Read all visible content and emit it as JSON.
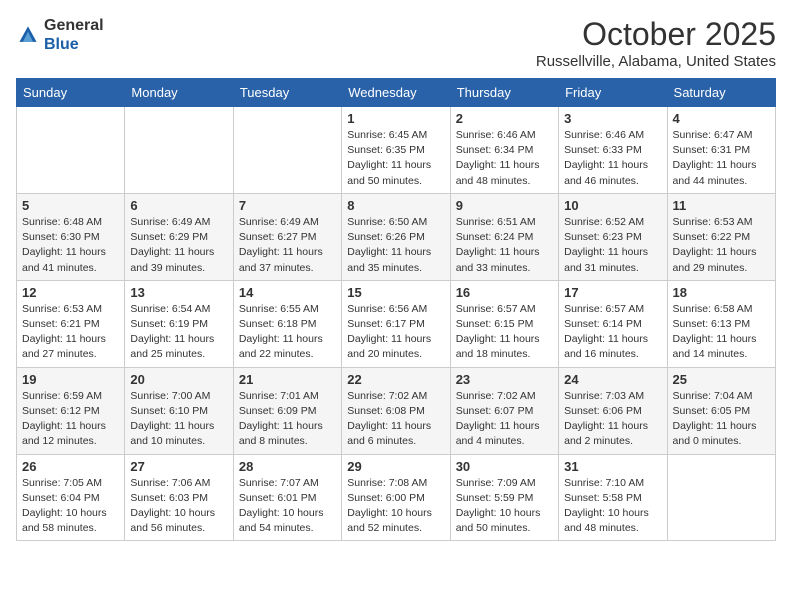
{
  "header": {
    "logo_line1": "General",
    "logo_line2": "Blue",
    "title": "October 2025",
    "subtitle": "Russellville, Alabama, United States"
  },
  "weekdays": [
    "Sunday",
    "Monday",
    "Tuesday",
    "Wednesday",
    "Thursday",
    "Friday",
    "Saturday"
  ],
  "weeks": [
    [
      {
        "day": "",
        "sunrise": "",
        "sunset": "",
        "daylight": ""
      },
      {
        "day": "",
        "sunrise": "",
        "sunset": "",
        "daylight": ""
      },
      {
        "day": "",
        "sunrise": "",
        "sunset": "",
        "daylight": ""
      },
      {
        "day": "1",
        "sunrise": "Sunrise: 6:45 AM",
        "sunset": "Sunset: 6:35 PM",
        "daylight": "Daylight: 11 hours and 50 minutes."
      },
      {
        "day": "2",
        "sunrise": "Sunrise: 6:46 AM",
        "sunset": "Sunset: 6:34 PM",
        "daylight": "Daylight: 11 hours and 48 minutes."
      },
      {
        "day": "3",
        "sunrise": "Sunrise: 6:46 AM",
        "sunset": "Sunset: 6:33 PM",
        "daylight": "Daylight: 11 hours and 46 minutes."
      },
      {
        "day": "4",
        "sunrise": "Sunrise: 6:47 AM",
        "sunset": "Sunset: 6:31 PM",
        "daylight": "Daylight: 11 hours and 44 minutes."
      }
    ],
    [
      {
        "day": "5",
        "sunrise": "Sunrise: 6:48 AM",
        "sunset": "Sunset: 6:30 PM",
        "daylight": "Daylight: 11 hours and 41 minutes."
      },
      {
        "day": "6",
        "sunrise": "Sunrise: 6:49 AM",
        "sunset": "Sunset: 6:29 PM",
        "daylight": "Daylight: 11 hours and 39 minutes."
      },
      {
        "day": "7",
        "sunrise": "Sunrise: 6:49 AM",
        "sunset": "Sunset: 6:27 PM",
        "daylight": "Daylight: 11 hours and 37 minutes."
      },
      {
        "day": "8",
        "sunrise": "Sunrise: 6:50 AM",
        "sunset": "Sunset: 6:26 PM",
        "daylight": "Daylight: 11 hours and 35 minutes."
      },
      {
        "day": "9",
        "sunrise": "Sunrise: 6:51 AM",
        "sunset": "Sunset: 6:24 PM",
        "daylight": "Daylight: 11 hours and 33 minutes."
      },
      {
        "day": "10",
        "sunrise": "Sunrise: 6:52 AM",
        "sunset": "Sunset: 6:23 PM",
        "daylight": "Daylight: 11 hours and 31 minutes."
      },
      {
        "day": "11",
        "sunrise": "Sunrise: 6:53 AM",
        "sunset": "Sunset: 6:22 PM",
        "daylight": "Daylight: 11 hours and 29 minutes."
      }
    ],
    [
      {
        "day": "12",
        "sunrise": "Sunrise: 6:53 AM",
        "sunset": "Sunset: 6:21 PM",
        "daylight": "Daylight: 11 hours and 27 minutes."
      },
      {
        "day": "13",
        "sunrise": "Sunrise: 6:54 AM",
        "sunset": "Sunset: 6:19 PM",
        "daylight": "Daylight: 11 hours and 25 minutes."
      },
      {
        "day": "14",
        "sunrise": "Sunrise: 6:55 AM",
        "sunset": "Sunset: 6:18 PM",
        "daylight": "Daylight: 11 hours and 22 minutes."
      },
      {
        "day": "15",
        "sunrise": "Sunrise: 6:56 AM",
        "sunset": "Sunset: 6:17 PM",
        "daylight": "Daylight: 11 hours and 20 minutes."
      },
      {
        "day": "16",
        "sunrise": "Sunrise: 6:57 AM",
        "sunset": "Sunset: 6:15 PM",
        "daylight": "Daylight: 11 hours and 18 minutes."
      },
      {
        "day": "17",
        "sunrise": "Sunrise: 6:57 AM",
        "sunset": "Sunset: 6:14 PM",
        "daylight": "Daylight: 11 hours and 16 minutes."
      },
      {
        "day": "18",
        "sunrise": "Sunrise: 6:58 AM",
        "sunset": "Sunset: 6:13 PM",
        "daylight": "Daylight: 11 hours and 14 minutes."
      }
    ],
    [
      {
        "day": "19",
        "sunrise": "Sunrise: 6:59 AM",
        "sunset": "Sunset: 6:12 PM",
        "daylight": "Daylight: 11 hours and 12 minutes."
      },
      {
        "day": "20",
        "sunrise": "Sunrise: 7:00 AM",
        "sunset": "Sunset: 6:10 PM",
        "daylight": "Daylight: 11 hours and 10 minutes."
      },
      {
        "day": "21",
        "sunrise": "Sunrise: 7:01 AM",
        "sunset": "Sunset: 6:09 PM",
        "daylight": "Daylight: 11 hours and 8 minutes."
      },
      {
        "day": "22",
        "sunrise": "Sunrise: 7:02 AM",
        "sunset": "Sunset: 6:08 PM",
        "daylight": "Daylight: 11 hours and 6 minutes."
      },
      {
        "day": "23",
        "sunrise": "Sunrise: 7:02 AM",
        "sunset": "Sunset: 6:07 PM",
        "daylight": "Daylight: 11 hours and 4 minutes."
      },
      {
        "day": "24",
        "sunrise": "Sunrise: 7:03 AM",
        "sunset": "Sunset: 6:06 PM",
        "daylight": "Daylight: 11 hours and 2 minutes."
      },
      {
        "day": "25",
        "sunrise": "Sunrise: 7:04 AM",
        "sunset": "Sunset: 6:05 PM",
        "daylight": "Daylight: 11 hours and 0 minutes."
      }
    ],
    [
      {
        "day": "26",
        "sunrise": "Sunrise: 7:05 AM",
        "sunset": "Sunset: 6:04 PM",
        "daylight": "Daylight: 10 hours and 58 minutes."
      },
      {
        "day": "27",
        "sunrise": "Sunrise: 7:06 AM",
        "sunset": "Sunset: 6:03 PM",
        "daylight": "Daylight: 10 hours and 56 minutes."
      },
      {
        "day": "28",
        "sunrise": "Sunrise: 7:07 AM",
        "sunset": "Sunset: 6:01 PM",
        "daylight": "Daylight: 10 hours and 54 minutes."
      },
      {
        "day": "29",
        "sunrise": "Sunrise: 7:08 AM",
        "sunset": "Sunset: 6:00 PM",
        "daylight": "Daylight: 10 hours and 52 minutes."
      },
      {
        "day": "30",
        "sunrise": "Sunrise: 7:09 AM",
        "sunset": "Sunset: 5:59 PM",
        "daylight": "Daylight: 10 hours and 50 minutes."
      },
      {
        "day": "31",
        "sunrise": "Sunrise: 7:10 AM",
        "sunset": "Sunset: 5:58 PM",
        "daylight": "Daylight: 10 hours and 48 minutes."
      },
      {
        "day": "",
        "sunrise": "",
        "sunset": "",
        "daylight": ""
      }
    ]
  ]
}
